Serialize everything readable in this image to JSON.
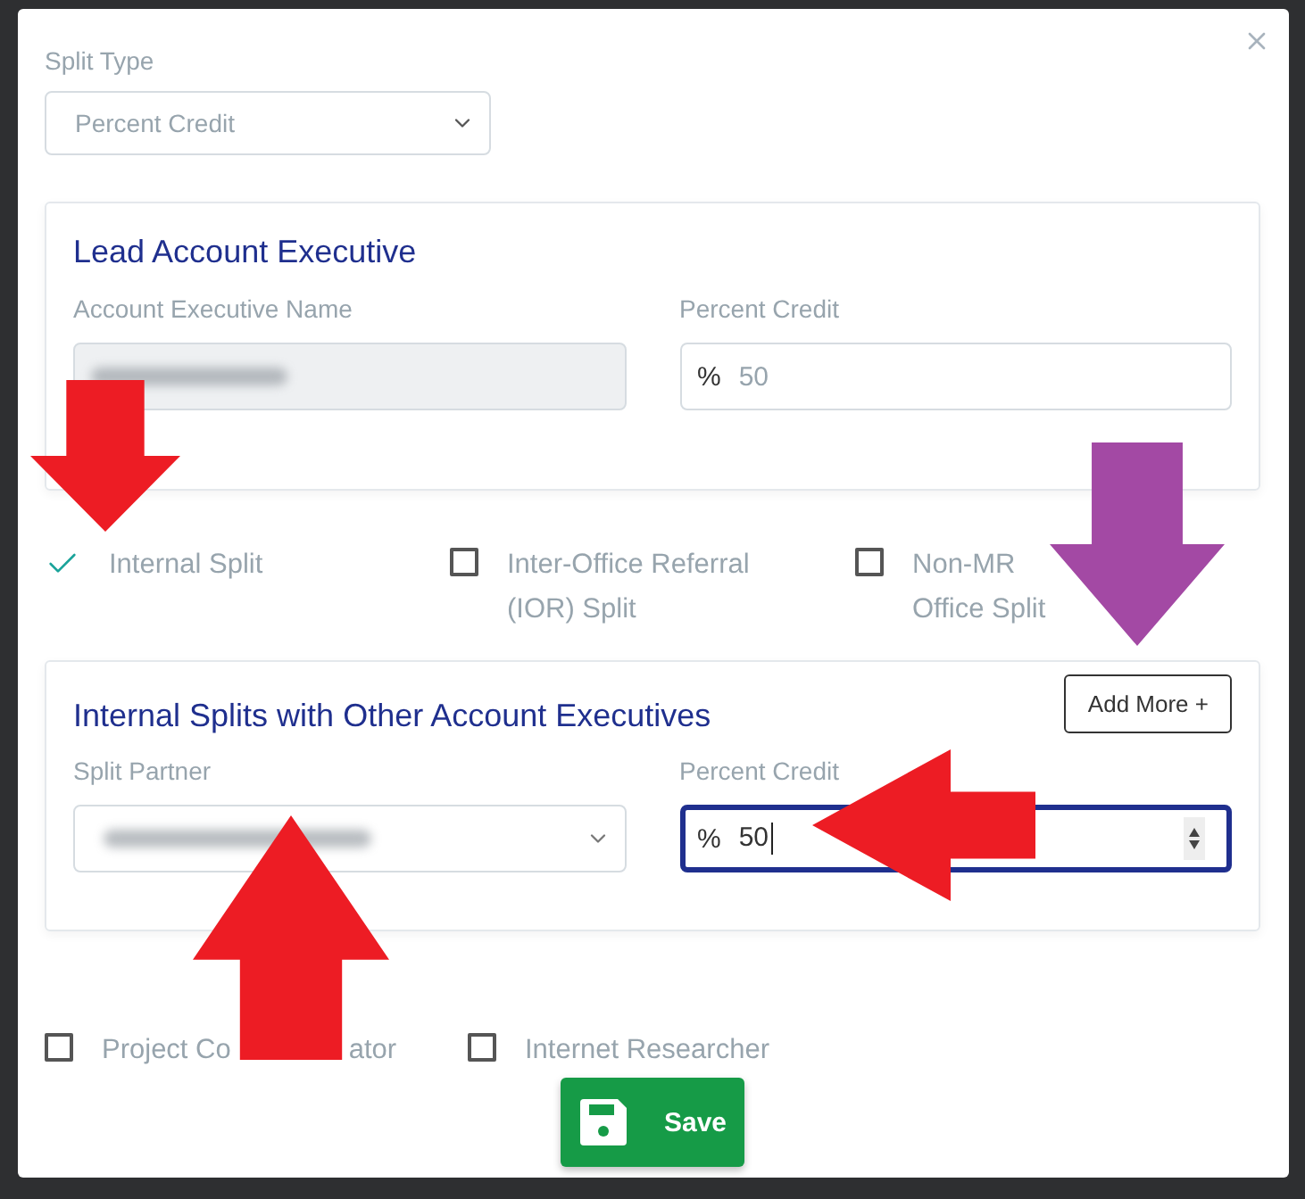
{
  "split_type": {
    "label": "Split Type",
    "value": "Percent Credit"
  },
  "lead_card": {
    "title": "Lead Account Executive",
    "name_label": "Account Executive Name",
    "name_disabled": true,
    "percent_label": "Percent Credit",
    "percent_prefix": "%",
    "percent_value": "50"
  },
  "split_options": [
    {
      "lines": [
        "Internal Split"
      ],
      "checked": true
    },
    {
      "lines": [
        "Inter-Office Referral",
        "(IOR) Split"
      ],
      "checked": false
    },
    {
      "lines": [
        "Non-MR",
        "Office Split"
      ],
      "checked": false
    }
  ],
  "internal_card": {
    "title": "Internal Splits with Other Account Executives",
    "add_button": "Add More +",
    "partner_label": "Split Partner",
    "percent_label": "Percent Credit",
    "percent_prefix": "%",
    "percent_value": "50",
    "focused": true
  },
  "role_options": [
    {
      "fragments": [
        "Project Co",
        "ator"
      ],
      "checked": false
    },
    {
      "fragments": [
        "Internet Researcher"
      ],
      "checked": false
    }
  ],
  "save_button": "Save",
  "annotations": [
    {
      "kind": "down",
      "color": "#ed1c24"
    },
    {
      "kind": "down",
      "color": "#a349a4"
    },
    {
      "kind": "left",
      "color": "#ed1c24"
    },
    {
      "kind": "up",
      "color": "#ed1c24"
    }
  ]
}
